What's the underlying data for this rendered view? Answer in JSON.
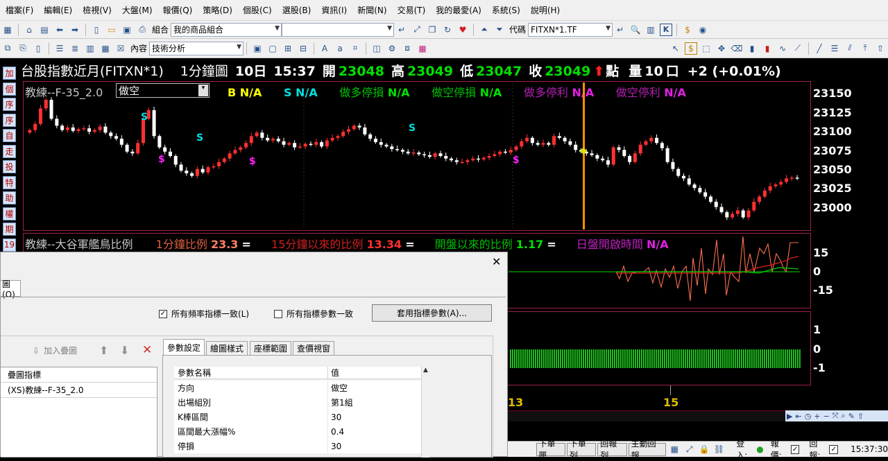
{
  "menu": [
    "檔案(F)",
    "編輯(E)",
    "檢視(V)",
    "大盤(M)",
    "報價(Q)",
    "策略(D)",
    "個股(C)",
    "選股(B)",
    "資訊(I)",
    "新聞(N)",
    "交易(T)",
    "我的最愛(A)",
    "系統(S)",
    "說明(H)"
  ],
  "toolbar1": {
    "group_label": "組合",
    "group_value": "我的商品組合",
    "code_label": "代碼",
    "code_value": "FITXN*1.TF"
  },
  "toolbar2": {
    "content_label": "內容",
    "content_value": "技術分析"
  },
  "leftbar": [
    "加",
    "個",
    "序",
    "序",
    "自",
    "走",
    "投",
    "特",
    "助",
    "權",
    "期",
    "19"
  ],
  "quote": {
    "name": "台股指數近月(FITXN*1)",
    "period": "1分鐘圖",
    "date": "10日",
    "time": "15:37",
    "open_label": "開",
    "open": "23048",
    "high_label": "高",
    "high": "23049",
    "low_label": "低",
    "low": "23047",
    "close_label": "收",
    "close": "23049",
    "unit": "點",
    "vol_label": "量",
    "vol": "10",
    "vol_unit": "口",
    "change": "+2 (+0.01%)"
  },
  "panel1": {
    "title": "教練--F-35_2.0",
    "direction": "做空",
    "b_label": "B",
    "b_value": "N/A",
    "s_label": "S",
    "s_value": "N/A",
    "long_stop_label": "做多停損",
    "long_stop_value": "N/A",
    "short_stop_label": "做空停損",
    "short_stop_value": "N/A",
    "long_profit_label": "做多停利",
    "long_profit_value": "N/A",
    "short_profit_label": "做空停利",
    "short_profit_value": "N/A",
    "yticks": [
      "23150",
      "23125",
      "23100",
      "23075",
      "23050",
      "23025",
      "23000"
    ],
    "signal_s": "S",
    "signal_dollar": "$"
  },
  "panel2": {
    "title": "教練--大谷軍艦鳥比例",
    "r1_label": "1分鐘比例",
    "r1_value": "23.3",
    "r2_label": "15分鐘以來的比例",
    "r2_value": "13.34",
    "r3_label": "開盤以來的比例",
    "r3_value": "1.17",
    "r4_label": "日盤開啟時間",
    "r4_value": "N/A",
    "eq": "=",
    "yticks": [
      "15",
      "0",
      "-15"
    ]
  },
  "panel3": {
    "yticks": [
      "1",
      "0",
      "-1"
    ]
  },
  "xaxis": [
    "13",
    "15"
  ],
  "dialog": {
    "tab_partial": "圖(O)",
    "chk1": "所有頻率指標一致(L)",
    "chk2": "所有指標參數一致",
    "apply_button": "套用指標參數(A)...",
    "add_button": "加入疊圖",
    "list_header": "疊圖指標",
    "list_item": "(XS)教練--F-35_2.0",
    "tabs": [
      "參數設定",
      "繪圖樣式",
      "座標範圍",
      "查價視窗"
    ],
    "grid_header": [
      "參數名稱",
      "值"
    ],
    "params": [
      {
        "name": "方向",
        "value": "做空"
      },
      {
        "name": "出場組別",
        "value": "第1組"
      },
      {
        "name": "K棒區間",
        "value": "30"
      },
      {
        "name": "區間最大漲幅%",
        "value": "0.4"
      },
      {
        "name": "停損",
        "value": "30"
      }
    ]
  },
  "status": {
    "buttons": [
      "下單匣",
      "下單列",
      "回報列",
      "主動回報"
    ],
    "login_label": "登入:",
    "quote_label": "報價:",
    "report_label": "回報:",
    "time": "15:37:30"
  },
  "chart_data": {
    "type": "candlestick",
    "ylim": [
      22990,
      23160
    ],
    "close": [
      23105,
      23112,
      23130,
      23140,
      23118,
      23110,
      23105,
      23108,
      23104,
      23106,
      23107,
      23103,
      23105,
      23109,
      23102,
      23098,
      23095,
      23088,
      23080,
      23078,
      23090,
      23118,
      23128,
      23098,
      23085,
      23080,
      23075,
      23065,
      23058,
      23055,
      23052,
      23060,
      23056,
      23062,
      23063,
      23068,
      23072,
      23078,
      23082,
      23085,
      23090,
      23098,
      23102,
      23096,
      23093,
      23095,
      23092,
      23088,
      23090,
      23085,
      23086,
      23089,
      23088,
      23091,
      23086,
      23093,
      23096,
      23098,
      23103,
      23106,
      23110,
      23108,
      23100,
      23095,
      23091,
      23088,
      23086,
      23083,
      23082,
      23080,
      23078,
      23079,
      23077,
      23076,
      23074,
      23078,
      23075,
      23072,
      23070,
      23068,
      23068,
      23070,
      23072,
      23071,
      23073,
      23075,
      23077,
      23080,
      23079,
      23082,
      23086,
      23092,
      23096,
      23090,
      23088,
      23090,
      23088,
      23098,
      23096,
      23092,
      23088,
      23082,
      23080,
      23078,
      23076,
      23072,
      23070,
      23065,
      23085,
      23082,
      23075,
      23068,
      23078,
      23088,
      23092,
      23096,
      23090,
      23084,
      23068,
      23060,
      23052,
      23049,
      23042,
      23038,
      23033,
      23028,
      23022,
      23016,
      23010,
      23004,
      23008,
      23012,
      23004,
      23012,
      23022,
      23028,
      23035,
      23040,
      23042,
      23045,
      23049,
      23050,
      23049
    ]
  }
}
